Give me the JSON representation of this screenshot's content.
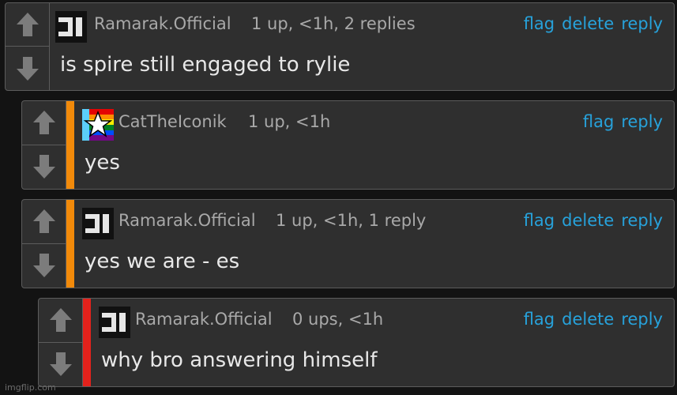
{
  "comments": [
    {
      "username": "Ramarak.Official",
      "meta": "1 up, <1h, 2 replies",
      "text": "is spire still engaged to rylie",
      "actions": {
        "flag": "flag",
        "delete": "delete",
        "reply": "reply"
      },
      "accent_color": ""
    },
    {
      "username": "CatTheIconik",
      "meta": "1 up, <1h",
      "text": "yes",
      "actions": {
        "flag": "flag",
        "reply": "reply"
      },
      "accent_color": "#f28a0a"
    },
    {
      "username": "Ramarak.Official",
      "meta": "1 up, <1h, 1 reply",
      "text": "yes we are - es",
      "actions": {
        "flag": "flag",
        "delete": "delete",
        "reply": "reply"
      },
      "accent_color": "#f28a0a"
    },
    {
      "username": "Ramarak.Official",
      "meta": "0 ups, <1h",
      "text": "why bro answering himself",
      "actions": {
        "flag": "flag",
        "delete": "delete",
        "reply": "reply"
      },
      "accent_color": "#e3221c"
    }
  ],
  "watermark": "imgflip.com",
  "colors": {
    "link": "#27a2db",
    "background": "#131313",
    "panel": "#2f2f2f"
  },
  "icons": [
    "up-arrow-icon",
    "down-arrow-icon",
    "pixel-avatar-icon",
    "rainbow-star-avatar-icon"
  ]
}
